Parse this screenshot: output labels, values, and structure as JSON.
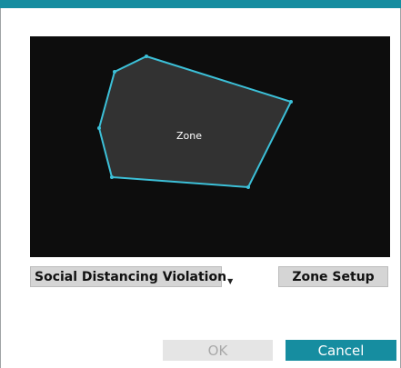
{
  "theme": {
    "accent": "#168da0",
    "video_bg": "#0d0d0d",
    "zone_fill": "#323232",
    "zone_stroke": "#3cc0d8",
    "button_gray": "#d5d5d5"
  },
  "video": {
    "zone_label": "Zone"
  },
  "controls": {
    "event_type": "Social Distancing Violation",
    "zone_setup_label": "Zone Setup"
  },
  "footer": {
    "ok_label": "OK",
    "ok_enabled": false,
    "cancel_label": "Cancel"
  }
}
